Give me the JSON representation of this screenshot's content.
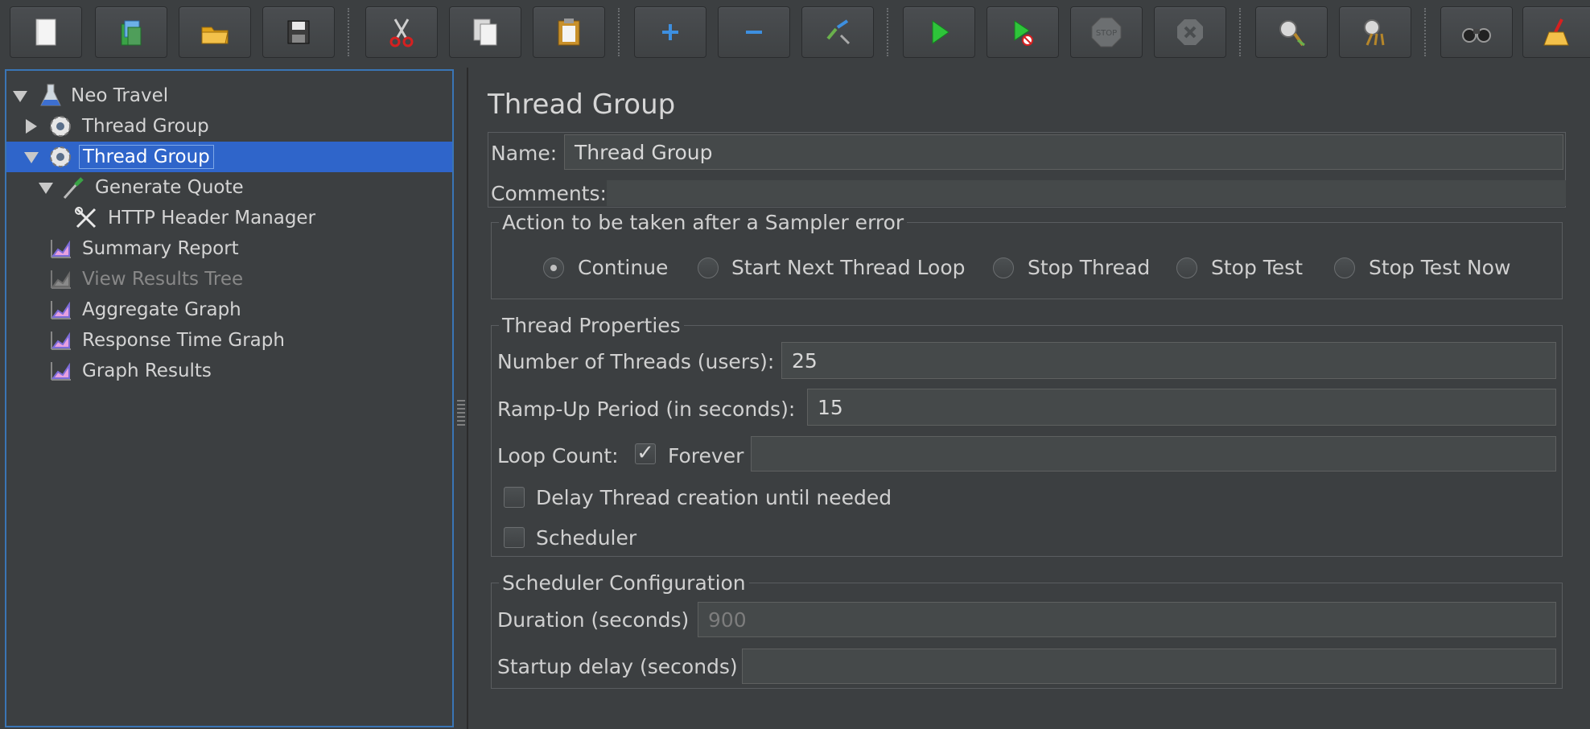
{
  "toolbar": {
    "buttons": [
      {
        "icon": "new-file-icon"
      },
      {
        "icon": "templates-icon"
      },
      {
        "icon": "open-folder-icon"
      },
      {
        "icon": "save-icon"
      },
      {
        "icon": "cut-icon"
      },
      {
        "icon": "copy-icon"
      },
      {
        "icon": "paste-icon"
      },
      {
        "icon": "expand-all-icon"
      },
      {
        "icon": "collapse-all-icon"
      },
      {
        "icon": "toggle-icon"
      },
      {
        "icon": "start-icon"
      },
      {
        "icon": "start-no-pauses-icon"
      },
      {
        "icon": "stop-icon"
      },
      {
        "icon": "shutdown-icon"
      },
      {
        "icon": "clear-icon"
      },
      {
        "icon": "clear-all-icon"
      },
      {
        "icon": "search-icon"
      },
      {
        "icon": "reset-search-icon"
      }
    ],
    "stop_text": "STOP"
  },
  "tree": {
    "items": [
      {
        "label": "Neo Travel",
        "icon": "flask-icon"
      },
      {
        "label": "Thread Group",
        "icon": "gear-icon"
      },
      {
        "label": "Thread Group",
        "icon": "gear-icon",
        "selected": true
      },
      {
        "label": "Generate Quote",
        "icon": "pipette-icon"
      },
      {
        "label": "HTTP Header Manager",
        "icon": "tools-icon"
      },
      {
        "label": "Summary Report",
        "icon": "graph-icon"
      },
      {
        "label": "View Results Tree",
        "icon": "graph-icon",
        "disabled": true
      },
      {
        "label": "Aggregate Graph",
        "icon": "graph-icon"
      },
      {
        "label": "Response Time Graph",
        "icon": "graph-icon"
      },
      {
        "label": "Graph Results",
        "icon": "graph-icon"
      }
    ]
  },
  "panel": {
    "title": "Thread Group",
    "name_label": "Name:",
    "name_value": "Thread Group",
    "comments_label": "Comments:",
    "comments_value": "",
    "sampler_error": {
      "title": "Action to be taken after a Sampler error",
      "options": [
        "Continue",
        "Start Next Thread Loop",
        "Stop Thread",
        "Stop Test",
        "Stop Test Now"
      ],
      "selected": "Continue"
    },
    "thread_properties": {
      "title": "Thread Properties",
      "threads_label": "Number of Threads (users):",
      "threads_value": "25",
      "rampup_label": "Ramp-Up Period (in seconds):",
      "rampup_value": "15",
      "loop_label": "Loop Count:",
      "forever_label": "Forever",
      "forever_checked": true,
      "loop_value": "",
      "delay_label": "Delay Thread creation until needed",
      "delay_checked": false,
      "scheduler_label": "Scheduler",
      "scheduler_checked": false
    },
    "scheduler_config": {
      "title": "Scheduler Configuration",
      "duration_label": "Duration (seconds)",
      "duration_value": "900",
      "startup_label": "Startup delay (seconds)",
      "startup_value": ""
    }
  }
}
